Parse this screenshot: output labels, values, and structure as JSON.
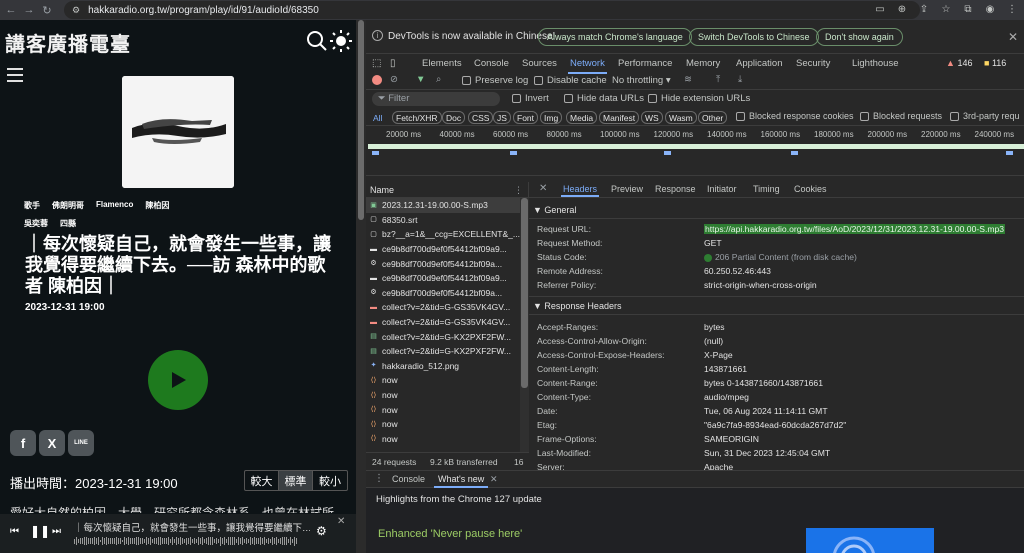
{
  "browser": {
    "url": "hakkaradio.org.tw/program/play/id/91/audioId/68350"
  },
  "page": {
    "logo_text": "講客廣播電臺",
    "tags_row1": [
      "歌手",
      "佛朗明哥",
      "Flamenco",
      "陳柏因"
    ],
    "tags_row2": [
      "吳奕蓉",
      "四縣"
    ],
    "title": "｜每次懷疑自己，就會發生一些事，讓我覺得要繼續下去。──訪 森林中的歌者 陳柏因｜",
    "date": "2023-12-31 19:00",
    "airtime_label": "播出時間：2023-12-31 19:00",
    "font_sizes": [
      "較大",
      "標準",
      "較小"
    ],
    "body_cut_text": "愛好大自然的柏因，大學、研究所都念森林系，也曾在林試所",
    "player_title": "｜每次懷疑自己，就會發生一些事，讓我覺得要繼續下…",
    "social": [
      "f",
      "X",
      "LINE"
    ]
  },
  "devtools": {
    "info_message": "DevTools is now available in Chinese!",
    "info_buttons": [
      "Always match Chrome's language",
      "Switch DevTools to Chinese",
      "Don't show again"
    ],
    "tabs": [
      "Elements",
      "Console",
      "Sources",
      "Network",
      "Performance",
      "Memory",
      "Application",
      "Security",
      "Lighthouse"
    ],
    "active_tab": "Network",
    "warnings_count": "146",
    "errors_count": "116",
    "toolbar": {
      "preserve_log": "Preserve log",
      "disable_cache": "Disable cache",
      "throttle": "No throttling",
      "filter_placeholder": "Filter",
      "invert": "Invert",
      "hide_data_urls": "Hide data URLs",
      "hide_ext_urls": "Hide extension URLs"
    },
    "type_filters": [
      "All",
      "Fetch/XHR",
      "Doc",
      "CSS",
      "JS",
      "Font",
      "Img",
      "Media",
      "Manifest",
      "WS",
      "Wasm",
      "Other"
    ],
    "blocked_response_cookies": "Blocked response cookies",
    "blocked_requests": "Blocked requests",
    "third_party": "3rd-party requ",
    "timeline_labels": [
      "20000 ms",
      "40000 ms",
      "60000 ms",
      "80000 ms",
      "100000 ms",
      "120000 ms",
      "140000 ms",
      "160000 ms",
      "180000 ms",
      "200000 ms",
      "220000 ms",
      "240000 ms"
    ],
    "requests_header": "Name",
    "requests": [
      "2023.12.31-19.00.00-S.mp3",
      "68350.srt",
      "bz?__a=1&__ccg=EXCELLENT&_...",
      "ce9b8df700d9ef0f54412bf09a9...",
      "ce9b8df700d9ef0f54412bf09a...",
      "ce9b8df700d9ef0f54412bf09a9...",
      "ce9b8df700d9ef0f54412bf09a...",
      "collect?v=2&tid=G-GS35VK4GV...",
      "collect?v=2&tid=G-GS35VK4GV...",
      "collect?v=2&tid=G-KX2PXF2FW...",
      "collect?v=2&tid=G-KX2PXF2FW...",
      "hakkaradio_512.png",
      "now",
      "now",
      "now",
      "now",
      "now"
    ],
    "status_bar": {
      "requests": "24 requests",
      "transferred": "9.2 kB transferred",
      "extra": "16"
    },
    "detail_tabs": [
      "Headers",
      "Preview",
      "Response",
      "Initiator",
      "Timing",
      "Cookies"
    ],
    "general_label": "▼ General",
    "general": [
      {
        "k": "Request URL:",
        "v": "https://api.hakkaradio.org.tw/files/AoD/2023/12/31/2023.12.31-19.00.00-S.mp3"
      },
      {
        "k": "Request Method:",
        "v": "GET"
      },
      {
        "k": "Status Code:",
        "v": "206 Partial Content (from disk cache)"
      },
      {
        "k": "Remote Address:",
        "v": "60.250.52.46:443"
      },
      {
        "k": "Referrer Policy:",
        "v": "strict-origin-when-cross-origin"
      }
    ],
    "response_label": "▼ Response Headers",
    "response_headers": [
      {
        "k": "Accept-Ranges:",
        "v": "bytes"
      },
      {
        "k": "Access-Control-Allow-Origin:",
        "v": "(null)"
      },
      {
        "k": "Access-Control-Expose-Headers:",
        "v": "X-Page"
      },
      {
        "k": "Content-Length:",
        "v": "143871661"
      },
      {
        "k": "Content-Range:",
        "v": "bytes 0-143871660/143871661"
      },
      {
        "k": "Content-Type:",
        "v": "audio/mpeg"
      },
      {
        "k": "Date:",
        "v": "Tue, 06 Aug 2024 11:14:11 GMT"
      },
      {
        "k": "Etag:",
        "v": "\"6a9c7fa9-8934ead-60dcda267d7d2\""
      },
      {
        "k": "Frame-Options:",
        "v": "SAMEORIGIN"
      },
      {
        "k": "Last-Modified:",
        "v": "Sun, 31 Dec 2023 12:45:04 GMT"
      },
      {
        "k": "Server:",
        "v": "Apache"
      }
    ],
    "drawer_tabs": [
      "Console",
      "What's new"
    ],
    "highlights": "Highlights from the Chrome 127 update",
    "enhanced": "Enhanced 'Never pause here'"
  }
}
